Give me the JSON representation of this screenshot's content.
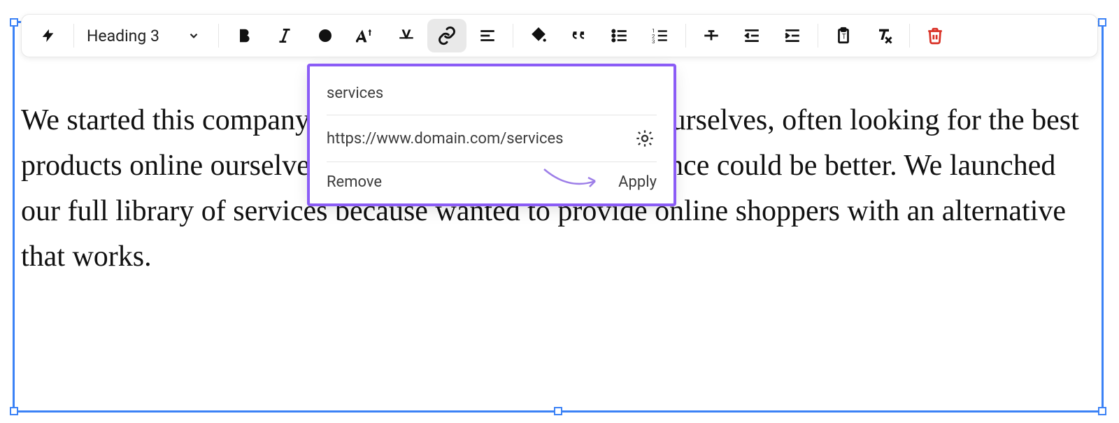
{
  "toolbar": {
    "format_label": "Heading 3"
  },
  "content": {
    "paragraph": "We started this company because we were consumers ourselves, often looking for the best products online ourselves—we just thought the experience could be better. We launched our full library of services because wanted to provide online shoppers with an alternative that works."
  },
  "link_popover": {
    "text": "services",
    "url": "https://www.domain.com/services",
    "remove_label": "Remove",
    "apply_label": "Apply"
  }
}
